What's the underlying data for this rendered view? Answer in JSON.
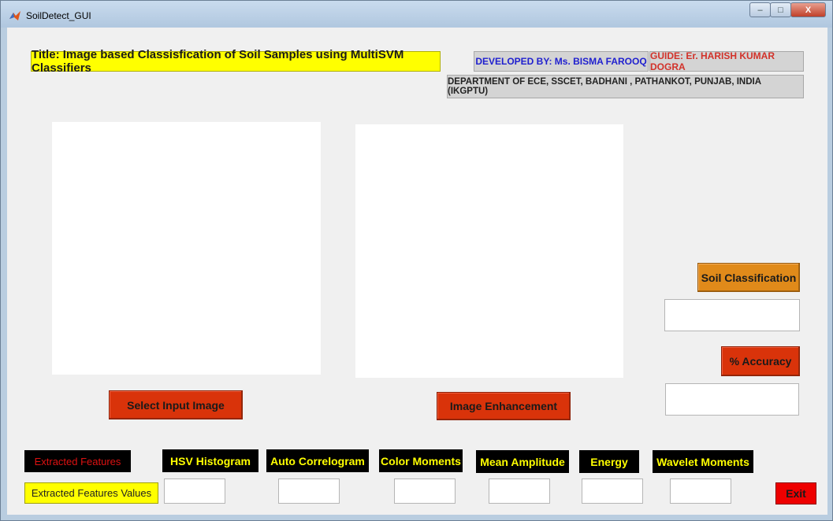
{
  "window": {
    "title": "SoilDetect_GUI",
    "controls": {
      "minimize": "–",
      "maximize": "□",
      "close": "X"
    }
  },
  "header": {
    "title": "Title: Image based Classisfication of Soil Samples using MultiSVM Classifiers",
    "developed_by": "DEVELOPED BY: Ms. BISMA FAROOQ",
    "guide": "GUIDE: Er. HARISH KUMAR DOGRA",
    "department": "DEPARTMENT OF ECE, SSCET, BADHANI , PATHANKOT, PUNJAB, INDIA  (IKGPTU)"
  },
  "buttons": {
    "select_input": "Select Input Image",
    "image_enhancement": "Image Enhancement",
    "soil_classification": "Soil Classification",
    "accuracy": "% Accuracy",
    "exit": "Exit"
  },
  "features": {
    "extracted_features": "Extracted Features",
    "extracted_features_values": "Extracted Features Values",
    "items": [
      {
        "label": "HSV Histogram",
        "value": ""
      },
      {
        "label": "Auto Correlogram",
        "value": ""
      },
      {
        "label": "Color Moments",
        "value": ""
      },
      {
        "label": "Mean Amplitude",
        "value": ""
      },
      {
        "label": "Energy",
        "value": ""
      },
      {
        "label": "Wavelet Moments",
        "value": ""
      }
    ]
  },
  "results": {
    "classification_value": "",
    "accuracy_value": ""
  },
  "colors": {
    "title_bg": "#ffff00",
    "developer_text": "#1f1fcf",
    "guide_text": "#d2322a",
    "red_button": "#d9330a",
    "orange_button": "#e08a1a",
    "exit_button": "#ee0000",
    "feature_label_bg": "#000000",
    "feature_label_text": "#ffff00"
  }
}
